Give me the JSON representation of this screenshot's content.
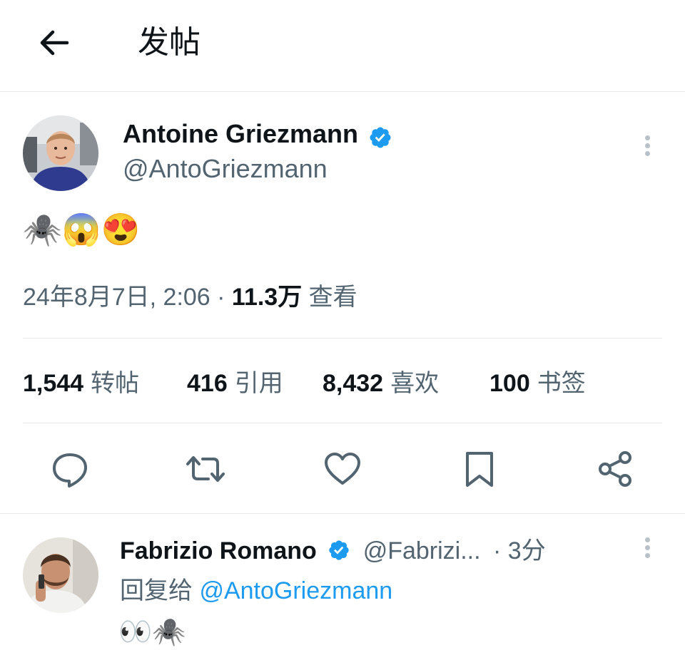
{
  "header": {
    "title": "发帖"
  },
  "tweet": {
    "author_name": "Antoine Griezmann",
    "author_handle": "@AntoGriezmann",
    "content": "🕷️😱😍",
    "date_time": "24年8月7日, 2:06 · ",
    "views_count": "11.3万",
    "views_label": " 查看",
    "stats": [
      {
        "count": "1,544",
        "label": "转帖"
      },
      {
        "count": "416",
        "label": "引用"
      },
      {
        "count": "8,432",
        "label": "喜欢"
      },
      {
        "count": "100",
        "label": "书签"
      }
    ],
    "actions": [
      "reply",
      "retweet",
      "like",
      "bookmark",
      "share"
    ]
  },
  "reply": {
    "author_name": "Fabrizio Romano",
    "author_handle": "@Fabrizi...",
    "time": "· 3分",
    "replying_to_prefix": "回复给 ",
    "replying_to_handle": "@AntoGriezmann",
    "content": "👀🕷️"
  },
  "colors": {
    "accent": "#1d9bf0",
    "text": "#0f1419",
    "muted": "#536471",
    "divider": "#e7e9ea"
  }
}
